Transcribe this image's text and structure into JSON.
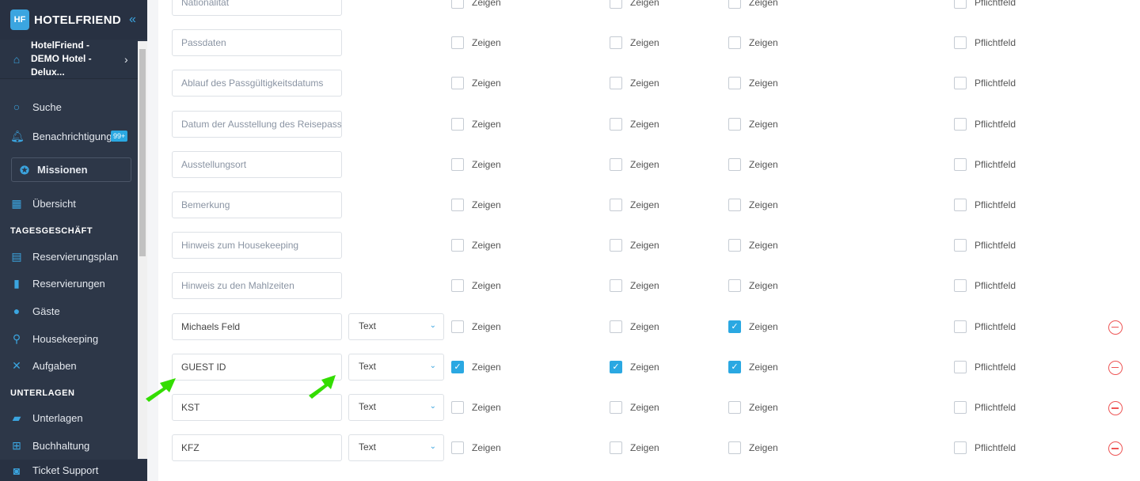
{
  "sidebar": {
    "brand": "HOTELFRIEND",
    "hotel": "HotelFriend - DEMO Hotel - Delux...",
    "search": "Suche",
    "notifications": "Benachrichtigungen",
    "badge": "99+",
    "missions": "Missionen",
    "overview": "Übersicht",
    "section1": "TAGESGESCHÄFT",
    "items1": [
      "Reservierungsplan",
      "Reservierungen",
      "Gäste",
      "Housekeeping",
      "Aufgaben"
    ],
    "section2": "UNTERLAGEN",
    "items2": [
      "Unterlagen",
      "Buchhaltung"
    ],
    "ticket": "Ticket Support"
  },
  "labels": {
    "show": "Zeigen",
    "required": "Pflichtfeld"
  },
  "rows": [
    {
      "field": "Nationalität",
      "placeholder": true,
      "c": [
        false,
        false,
        false,
        false
      ]
    },
    {
      "field": "Passdaten",
      "placeholder": true,
      "c": [
        false,
        false,
        false,
        false
      ]
    },
    {
      "field": "Ablauf des Passgültigkeitsdatums",
      "placeholder": true,
      "c": [
        false,
        false,
        false,
        false
      ]
    },
    {
      "field": "Datum der Ausstellung des Reisepasses",
      "placeholder": true,
      "c": [
        false,
        false,
        false,
        false
      ]
    },
    {
      "field": "Ausstellungsort",
      "placeholder": true,
      "c": [
        false,
        false,
        false,
        false
      ]
    },
    {
      "field": "Bemerkung",
      "placeholder": true,
      "c": [
        false,
        false,
        false,
        false
      ]
    },
    {
      "field": "Hinweis zum Housekeeping",
      "placeholder": true,
      "c": [
        false,
        false,
        false,
        false
      ]
    },
    {
      "field": "Hinweis zu den Mahlzeiten",
      "placeholder": true,
      "c": [
        false,
        false,
        false,
        false
      ]
    },
    {
      "field": "Michaels Feld",
      "type": "Text",
      "c": [
        false,
        false,
        true,
        false
      ],
      "removable": true
    },
    {
      "field": "GUEST ID",
      "type": "Text",
      "c": [
        true,
        true,
        true,
        false
      ],
      "removable": true
    },
    {
      "field": "KST",
      "type": "Text",
      "c": [
        false,
        false,
        false,
        false
      ],
      "removable": true
    },
    {
      "field": "KFZ",
      "type": "Text",
      "c": [
        false,
        false,
        false,
        false
      ],
      "removable": true
    }
  ],
  "colors": {
    "accent": "#2aa8e2",
    "sidebar": "#2d3748",
    "remove": "#e55555",
    "annotation_arrow": "#33dd00"
  }
}
